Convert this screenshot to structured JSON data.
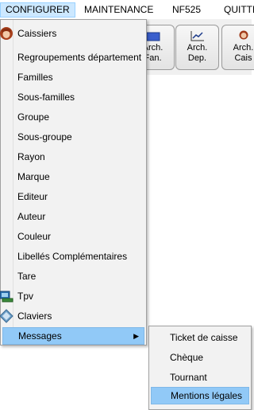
{
  "menubar": {
    "items": [
      "CONFIGURER",
      "MAINTENANCE",
      "NF525",
      "QUITTE"
    ]
  },
  "toolbar": {
    "buttons": [
      {
        "line1": "Arch.",
        "line2": "Fan.",
        "icon": "folder-icon"
      },
      {
        "line1": "Arch.",
        "line2": "Dep.",
        "icon": "chart-icon"
      },
      {
        "line1": "Arch.",
        "line2": "Cais",
        "icon": "cashier-avatar-icon"
      }
    ]
  },
  "menu": {
    "items": [
      {
        "label": "Caissiers",
        "icon": "cashier-avatar-icon"
      },
      {
        "label": "Regroupements département"
      },
      {
        "label": "Familles"
      },
      {
        "label": "Sous-familles"
      },
      {
        "label": "Groupe"
      },
      {
        "label": "Sous-groupe"
      },
      {
        "label": "Rayon"
      },
      {
        "label": "Marque"
      },
      {
        "label": "Editeur"
      },
      {
        "label": "Auteur"
      },
      {
        "label": "Couleur"
      },
      {
        "label": "Libellés Complémentaires"
      },
      {
        "label": "Tare"
      },
      {
        "label": "Tpv",
        "icon": "pos-terminal-icon"
      },
      {
        "label": "Claviers",
        "icon": "keyboard-icon"
      },
      {
        "label": "Messages",
        "submenu": true,
        "highlighted": true
      }
    ]
  },
  "submenu": {
    "items": [
      {
        "label": "Ticket de caisse"
      },
      {
        "label": "Chèque"
      },
      {
        "label": "Tournant"
      },
      {
        "label": "Mentions légales",
        "highlighted": true
      }
    ]
  },
  "colors": {
    "highlight": "#91c9f7",
    "active_menu": "#cce8ff",
    "menu_bg": "#f2f2f2"
  }
}
